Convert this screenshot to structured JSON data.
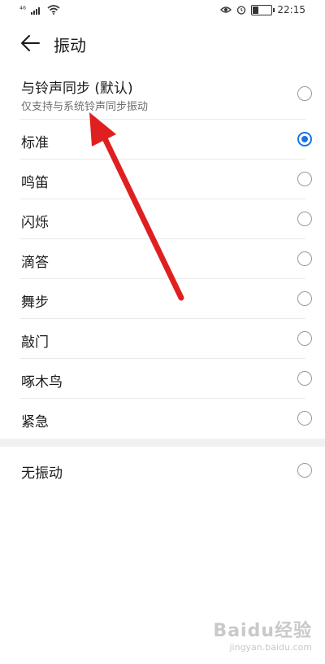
{
  "statusbar": {
    "network": "⁴⁶",
    "time": "22:15",
    "battery_level": 0.35,
    "icons": [
      "signal-icon",
      "wifi-icon",
      "eye-icon",
      "alarm-icon",
      "battery-icon"
    ]
  },
  "header": {
    "title": "振动",
    "back_icon": "back-arrow-icon"
  },
  "list": {
    "sync": {
      "label": "与铃声同步 (默认)",
      "subtitle": "仅支持与系统铃声同步振动"
    },
    "items": [
      {
        "label": "标准"
      },
      {
        "label": "鸣笛"
      },
      {
        "label": "闪烁"
      },
      {
        "label": "滴答"
      },
      {
        "label": "舞步"
      },
      {
        "label": "敲门"
      },
      {
        "label": "啄木鸟"
      },
      {
        "label": "紧急"
      }
    ],
    "none": {
      "label": "无振动"
    },
    "selected": "标准"
  },
  "colors": {
    "accent": "#1a73e8",
    "annotation_arrow": "#e02020"
  },
  "watermark": {
    "main": "Baidu经验",
    "sub": "jingyan.baidu.com"
  }
}
